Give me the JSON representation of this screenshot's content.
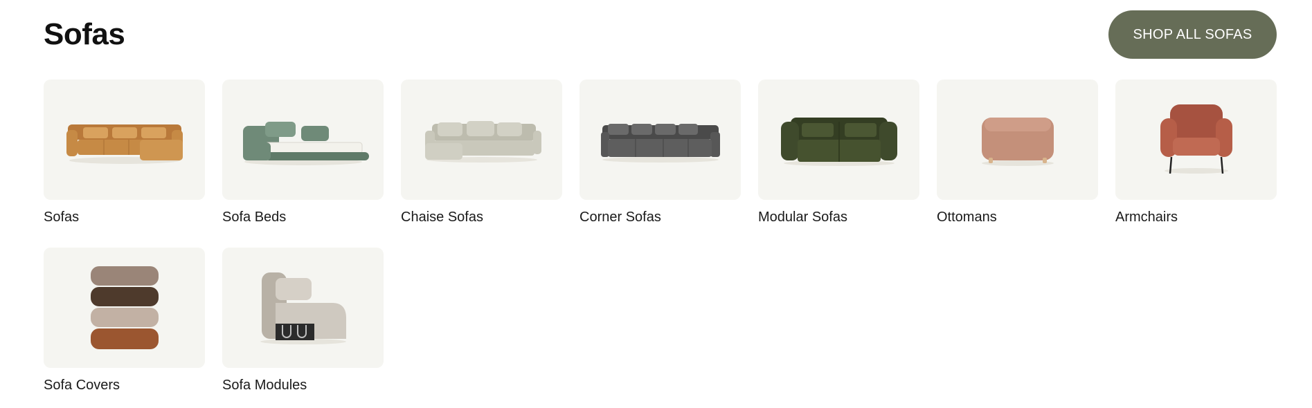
{
  "header": {
    "title": "Sofas",
    "shop_all_label": "SHOP ALL SOFAS"
  },
  "categories": [
    {
      "label": "Sofas",
      "icon": "l-shaped-sofa-icon",
      "color": "#c68a45"
    },
    {
      "label": "Sofa Beds",
      "icon": "sofa-bed-icon",
      "color": "#6f8a78"
    },
    {
      "label": "Chaise Sofas",
      "icon": "chaise-sofa-icon",
      "color": "#c9c8bb"
    },
    {
      "label": "Corner Sofas",
      "icon": "corner-sofa-icon",
      "color": "#5a5a5a"
    },
    {
      "label": "Modular Sofas",
      "icon": "modular-sofa-icon",
      "color": "#3f4a2c"
    },
    {
      "label": "Ottomans",
      "icon": "ottoman-icon",
      "color": "#c4907a"
    },
    {
      "label": "Armchairs",
      "icon": "armchair-icon",
      "color": "#b65e48"
    },
    {
      "label": "Sofa Covers",
      "icon": "sofa-covers-icon",
      "color": "#7b5a44"
    },
    {
      "label": "Sofa Modules",
      "icon": "sofa-module-icon",
      "color": "#cfc9c0"
    }
  ]
}
